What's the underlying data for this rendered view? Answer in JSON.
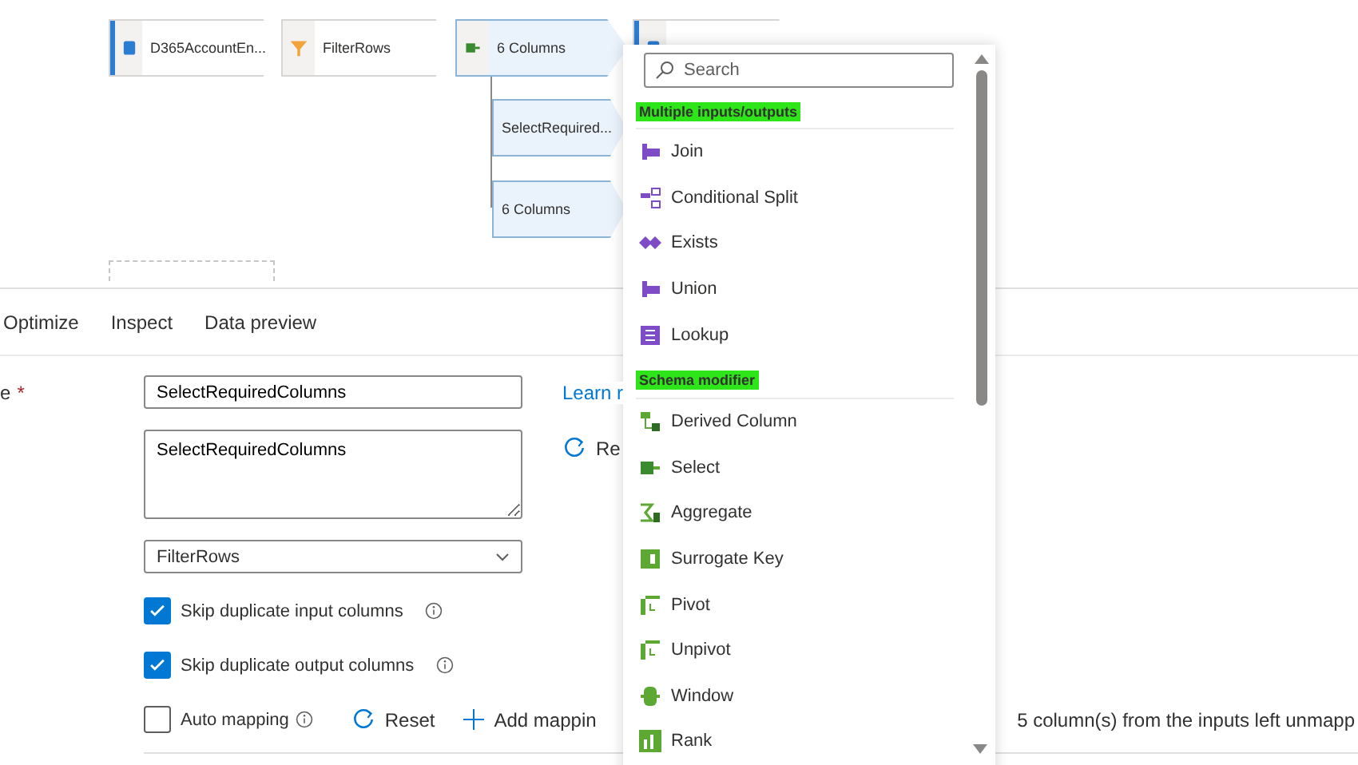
{
  "canvas": {
    "nodes": [
      {
        "label": "D365AccountEn...",
        "kind": "source",
        "selected": false
      },
      {
        "label": "FilterRows",
        "kind": "filter",
        "selected": false
      },
      {
        "label": "6 Columns",
        "kind": "select",
        "selected": true
      },
      {
        "label": "SelectRequired...",
        "kind": "branch",
        "selected": true
      },
      {
        "label": "6 Columns",
        "kind": "branch",
        "selected": true
      },
      {
        "kind": "sink",
        "selected": false
      }
    ]
  },
  "tabs": [
    {
      "label": "Optimize"
    },
    {
      "label": "Inspect"
    },
    {
      "label": "Data preview"
    }
  ],
  "form": {
    "name_label": "e",
    "required_mark": "*",
    "name_value": "SelectRequiredColumns",
    "description_value": "SelectRequiredColumns",
    "learn_link": "Learn r",
    "reset_side": "Re",
    "stream_value": "FilterRows",
    "options": [
      {
        "label": "Skip duplicate input columns",
        "checked": true
      },
      {
        "label": "Skip duplicate output columns",
        "checked": true
      }
    ],
    "auto_mapping": {
      "label": "Auto mapping",
      "checked": false
    },
    "reset": "Reset",
    "add_mapping": "Add mappin",
    "unmapped_note": "5 column(s) from the inputs left unmapp"
  },
  "menu": {
    "search": {
      "placeholder": "Search"
    },
    "groups": [
      {
        "title": "Multiple inputs/outputs",
        "items": [
          {
            "label": "Join"
          },
          {
            "label": "Conditional Split"
          },
          {
            "label": "Exists"
          },
          {
            "label": "Union"
          },
          {
            "label": "Lookup"
          }
        ]
      },
      {
        "title": "Schema modifier",
        "items": [
          {
            "label": "Derived Column"
          },
          {
            "label": "Select"
          },
          {
            "label": "Aggregate"
          },
          {
            "label": "Surrogate Key"
          },
          {
            "label": "Pivot"
          },
          {
            "label": "Unpivot"
          },
          {
            "label": "Window"
          },
          {
            "label": "Rank"
          }
        ]
      }
    ]
  }
}
